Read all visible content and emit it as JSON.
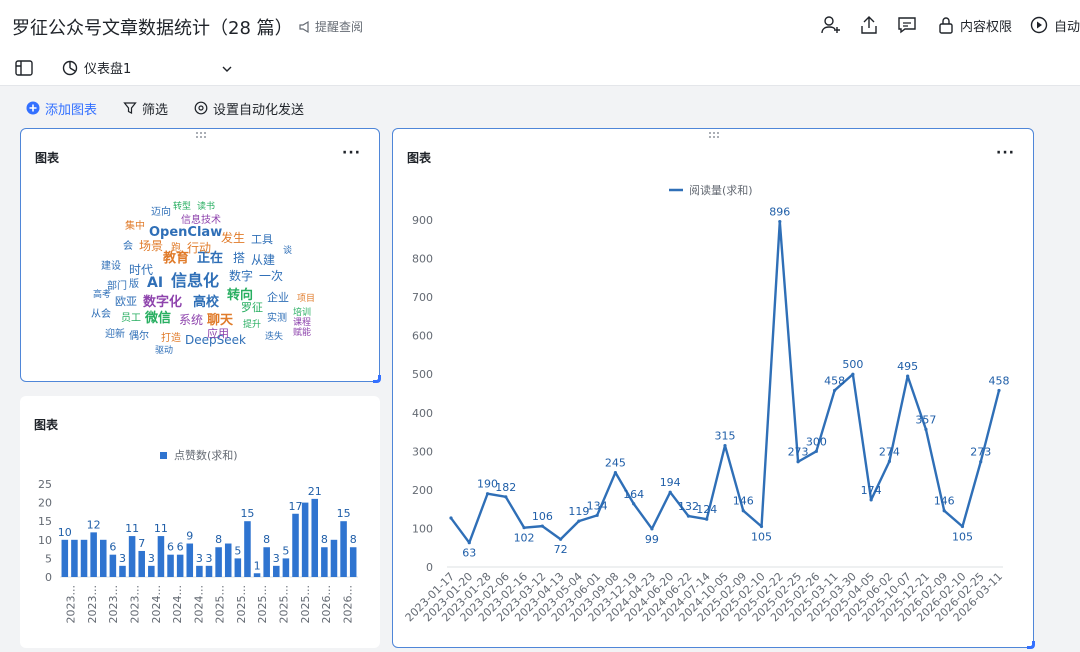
{
  "header": {
    "title": "罗征公众号文章数据统计（28 篇）",
    "remind_label": "提醒查阅",
    "permission_label": "内容权限",
    "auto_label": "自动"
  },
  "viewbar": {
    "tab_label": "仪表盘1"
  },
  "actions": {
    "add_chart": "添加图表",
    "filter": "筛选",
    "auto_send": "设置自动化发送"
  },
  "colors": {
    "accent": "#3370ff",
    "bar": "#2f74d0",
    "line": "#2f6fb7",
    "value_label": "#1f5ea8"
  },
  "wordcloud_card": {
    "title": "图表",
    "words": [
      {
        "t": "信息化",
        "c": "#2f6fb7"
      },
      {
        "t": "AI",
        "c": "#2f6fb7"
      },
      {
        "t": "教育",
        "c": "#e07b2a"
      },
      {
        "t": "正在",
        "c": "#2f6fb7"
      },
      {
        "t": "OpenClaw",
        "c": "#2f6fb7"
      },
      {
        "t": "数字化",
        "c": "#8e44ad"
      },
      {
        "t": "高校",
        "c": "#2f6fb7"
      },
      {
        "t": "转向",
        "c": "#27ae60"
      },
      {
        "t": "DeepSeek",
        "c": "#2f6fb7"
      },
      {
        "t": "微信",
        "c": "#27ae60"
      },
      {
        "t": "系统",
        "c": "#8e44ad"
      },
      {
        "t": "聊天",
        "c": "#e07b2a"
      },
      {
        "t": "时代",
        "c": "#2f6fb7"
      },
      {
        "t": "场景",
        "c": "#e07b2a"
      },
      {
        "t": "行动",
        "c": "#e07b2a"
      },
      {
        "t": "发生",
        "c": "#e07b2a"
      },
      {
        "t": "搭",
        "c": "#2f6fb7"
      },
      {
        "t": "从建",
        "c": "#2f6fb7"
      },
      {
        "t": "数字",
        "c": "#2f6fb7"
      },
      {
        "t": "一次",
        "c": "#2f6fb7"
      },
      {
        "t": "工具",
        "c": "#2f6fb7"
      },
      {
        "t": "企业",
        "c": "#2f6fb7"
      },
      {
        "t": "罗征",
        "c": "#27ae60"
      },
      {
        "t": "实测",
        "c": "#2f6fb7"
      },
      {
        "t": "应用",
        "c": "#8e44ad"
      },
      {
        "t": "打造",
        "c": "#e07b2a"
      },
      {
        "t": "员工",
        "c": "#27ae60"
      },
      {
        "t": "欧亚",
        "c": "#2f6fb7"
      },
      {
        "t": "部门",
        "c": "#2f6fb7"
      },
      {
        "t": "建设",
        "c": "#2f6fb7"
      },
      {
        "t": "信息技术",
        "c": "#8e44ad"
      },
      {
        "t": "迈向",
        "c": "#2f6fb7"
      },
      {
        "t": "转型",
        "c": "#27ae60"
      },
      {
        "t": "读书",
        "c": "#27ae60"
      },
      {
        "t": "集中",
        "c": "#e07b2a"
      },
      {
        "t": "会",
        "c": "#2f6fb7"
      },
      {
        "t": "提升",
        "c": "#27ae60"
      },
      {
        "t": "迭失",
        "c": "#2f6fb7"
      },
      {
        "t": "赋能",
        "c": "#8e44ad"
      },
      {
        "t": "课程",
        "c": "#8e44ad"
      },
      {
        "t": "项目",
        "c": "#e07b2a"
      },
      {
        "t": "高考",
        "c": "#2f6fb7"
      },
      {
        "t": "从会",
        "c": "#2f6fb7"
      },
      {
        "t": "迎新",
        "c": "#2f6fb7"
      },
      {
        "t": "偶尔",
        "c": "#2f6fb7"
      },
      {
        "t": "驱动",
        "c": "#2f6fb7"
      },
      {
        "t": "谈",
        "c": "#2f6fb7"
      },
      {
        "t": "跑",
        "c": "#e07b2a"
      },
      {
        "t": "版",
        "c": "#2f6fb7"
      },
      {
        "t": "培训",
        "c": "#27ae60"
      }
    ]
  },
  "bar_card": {
    "title": "图表",
    "chart_data": {
      "type": "bar",
      "legend": "点赞数(求和)",
      "ylim": [
        0,
        25
      ],
      "yticks": [
        "0",
        "5",
        "10",
        "15",
        "20",
        "25"
      ],
      "values": [
        10,
        10,
        10,
        12,
        10,
        6,
        3,
        11,
        7,
        3,
        11,
        6,
        6,
        9,
        3,
        3,
        8,
        9,
        5,
        15,
        1,
        8,
        3,
        5,
        17,
        20,
        21,
        8,
        10,
        15,
        8
      ],
      "labels": [
        "10",
        "",
        "",
        "12",
        "",
        "6",
        "3",
        "11",
        "7",
        "3",
        "11",
        "6",
        "6",
        "9",
        "3",
        "3",
        "8",
        "",
        "5",
        "15",
        "1",
        "8",
        "3",
        "5",
        "17",
        "",
        "21",
        "8",
        "",
        "15",
        "8"
      ],
      "xlabels": [
        "2023...",
        "2023...",
        "2023...",
        "2023...",
        "2024...",
        "2024...",
        "2024...",
        "2025...",
        "2025...",
        "2025...",
        "2025...",
        "2025...",
        "2026...",
        "2026..."
      ]
    }
  },
  "line_card": {
    "title": "图表",
    "chart_data": {
      "type": "line",
      "legend": "阅读量(求和)",
      "ylim": [
        0,
        900
      ],
      "yticks": [
        "0",
        "100",
        "200",
        "300",
        "400",
        "500",
        "600",
        "700",
        "800",
        "900"
      ],
      "x": [
        "2023-01-17",
        "",
        "2023-01-28",
        "2023-02-06",
        "2023-02-16",
        "2023-03-12",
        "2023-04-13",
        "2023-05-04",
        "2023-06-01",
        "2023-09-08",
        "2023-12-19",
        "2024-04-23",
        "2024-06-20",
        "2024-06-22",
        "2024-07-14",
        "2024-10-05",
        "2025-02-09",
        "2025-02-10",
        "2025-02-22",
        "2025-02-25",
        "2025-02-26",
        "2025-03-11",
        "2025-03-30",
        "2025-04-05",
        "2025-06-02",
        "2025-10-07",
        "2025-12-21",
        "2026-02-09",
        "2026-02-10",
        "2026-02-25",
        "2026-03-11"
      ],
      "xlabels": [
        "2023-01-17",
        "2023-01-20",
        "2023-01-28",
        "2023-02-06",
        "2023-02-16",
        "2023-03-12",
        "2023-04-13",
        "2023-05-04",
        "2023-06-01",
        "2023-09-08",
        "2023-12-19",
        "2024-04-23",
        "2024-06-20",
        "2024-06-22",
        "2024-07-14",
        "2024-10-05",
        "2025-02-09",
        "2025-02-10",
        "2025-02-22",
        "2025-02-25",
        "2025-02-26",
        "2025-03-11",
        "2025-03-30",
        "2025-04-05",
        "2025-06-02",
        "2025-10-07",
        "2025-12-21",
        "2026-02-09",
        "2026-02-10",
        "2026-02-25",
        "2026-03-11"
      ],
      "values": [
        127,
        63,
        190,
        182,
        102,
        106,
        72,
        119,
        134,
        245,
        164,
        99,
        194,
        132,
        124,
        315,
        146,
        105,
        896,
        273,
        300,
        458,
        500,
        174,
        274,
        495,
        357,
        146,
        105,
        273,
        458
      ],
      "labels": [
        "",
        "63",
        "190",
        "182",
        "102",
        "106",
        "72",
        "119",
        "134",
        "245",
        "164",
        "99",
        "194",
        "132",
        "124",
        "315",
        "146",
        "105",
        "896",
        "273",
        "300",
        "458",
        "500",
        "174",
        "274",
        "495",
        "357",
        "146",
        "105",
        "273",
        "458"
      ]
    }
  }
}
